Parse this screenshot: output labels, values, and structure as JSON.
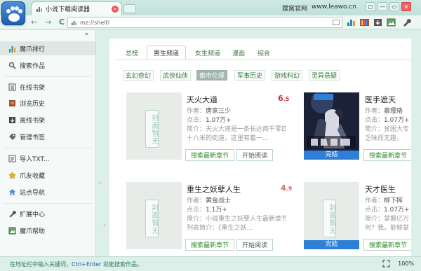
{
  "titlebar": {
    "tab_title": "小说下载阅读器",
    "tab_close": "×",
    "site_label": "狸窝官网",
    "site_url": "www.leawo.cn",
    "window_buttons": [
      "◻",
      "—",
      "▭",
      "×"
    ]
  },
  "navbar": {
    "back": "←",
    "forward": "→",
    "refresh": "C",
    "address": "mz://shelf/"
  },
  "sidebar": {
    "collapse": "«",
    "items": [
      {
        "label": "魔爪排行",
        "icon": "chart-icon"
      },
      {
        "label": "搜索作品",
        "icon": "search-icon"
      },
      {
        "label": "在线书架",
        "icon": "book-icon"
      },
      {
        "label": "浏览历史",
        "icon": "history-icon"
      },
      {
        "label": "离线书架",
        "icon": "download-icon"
      },
      {
        "label": "管理书签",
        "icon": "bookmark-icon"
      },
      {
        "label": "导入TXT...",
        "icon": "import-icon"
      },
      {
        "label": "爪友收藏",
        "icon": "star-icon"
      },
      {
        "label": "站点导航",
        "icon": "home-icon"
      },
      {
        "label": "扩展中心",
        "icon": "wrench-icon"
      },
      {
        "label": "魔爪帮助",
        "icon": "help-icon"
      }
    ]
  },
  "categories": [
    "总榜",
    "男生频道",
    "女生频道",
    "漫画",
    "综合"
  ],
  "subcategories": [
    "玄幻奇幻",
    "武侠仙侠",
    "都市伦理",
    "军事历史",
    "游戏科幻",
    "灵异悬疑"
  ],
  "labels": {
    "author": "作者：",
    "clicks": "点击：",
    "intro": "简介：",
    "search_chapter": "搜索最新章节",
    "start_reading": "开始阅读",
    "completed": "完結",
    "placeholder": "封面暂无",
    "intro_label": "列表简介："
  },
  "books": [
    {
      "title": "天火大道",
      "score_int": "6",
      "score_dec": ".5",
      "author": "唐家三少",
      "clicks": "1.07万+",
      "desc1": "天火大道是一条长达两千零四",
      "desc2": "十八米的街道，这里有着一...",
      "cover": "placeholder"
    },
    {
      "title": "医手遮天",
      "author": "慕璎珞",
      "clicks": "1.07万+",
      "desc1": "贫困大专",
      "desc2": "乏味而无趣，",
      "cover": "real"
    },
    {
      "title": "重生之妖孽人生",
      "score_int": "4",
      "score_dec": ".9",
      "author": "黄金战士",
      "clicks": "1.1万+",
      "desc1": "小说重生之妖孽人生最新章节",
      "desc2": "《重生之妖...",
      "cover": "placeholder"
    },
    {
      "title": "天才医生",
      "author": "柳下挥",
      "clicks": "1.07万+",
      "desc1": "掌握亿万",
      "desc2": "何？我，能够掌",
      "cover": "placeholder_done"
    }
  ],
  "status": {
    "text_before": "在地址栏中输入关键词，",
    "hotkey": "Ctrl+Enter",
    "text_after": " 就能搜索作品。",
    "zoom": "100%"
  }
}
